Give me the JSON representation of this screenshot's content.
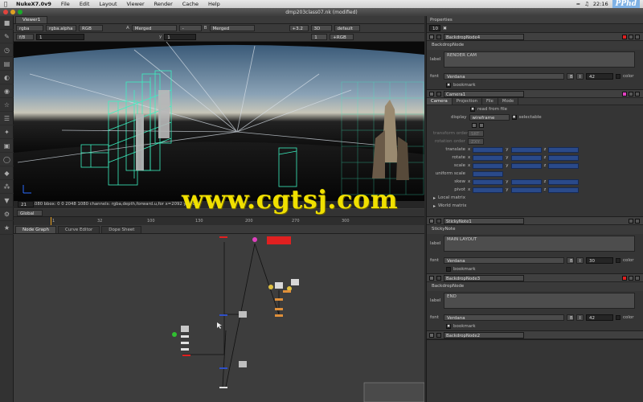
{
  "menubar": {
    "app": "NukeX7.0v9",
    "items": [
      "File",
      "Edit",
      "Layout",
      "Viewer",
      "Render",
      "Cache",
      "Help"
    ],
    "clock": "22:16",
    "logo": "PPhd"
  },
  "window": {
    "title": "dmp203class07.nk (modified)"
  },
  "viewer": {
    "tab": "Viewer1",
    "channels": "rgba",
    "alpha_channel": "rgba.alpha",
    "colorspace": "RGB",
    "a_label": "A",
    "a_input": "Merged",
    "b_label": "B",
    "b_input": "Merged",
    "zoom": "+3.2",
    "view_mode": "3D",
    "lut": "default",
    "aspect": "+RGB",
    "f_stop": "f/8",
    "frame_ratio": "1",
    "y_label": "y",
    "y_value": "1",
    "one": "1",
    "info": "2048x1080  bbox: 0 0 2048 1080 channels: rgba,depth,forward.u,for  x=2092 y=1008",
    "timeline_ticks": [
      "1",
      "32",
      "100",
      "130",
      "200",
      "270",
      "300"
    ],
    "current_frame": "21",
    "global_label": "Global"
  },
  "nodegraph": {
    "tabs": [
      "Node Graph",
      "Curve Editor",
      "Dope Sheet"
    ]
  },
  "watermark": "www.cgtsj.com",
  "properties": {
    "title": "Properties",
    "count": "10",
    "panels": [
      {
        "name": "BackdropNode4",
        "type": "BackdropNode",
        "label_title": "label",
        "label": "RENDER CAM",
        "font_label": "font",
        "font": "Verdana",
        "bold": "B",
        "italic": "I",
        "size": "42",
        "color_label": "color",
        "bookmark": "bookmark"
      },
      {
        "name": "Camera1",
        "tabs": [
          "Camera",
          "Projection",
          "File",
          "Mode"
        ],
        "read_from_file": "read from file",
        "display_label": "display",
        "display": "wireframe",
        "selectable": "selectable",
        "transform_order_label": "transform order",
        "transform_order": "SRT",
        "rotation_order_label": "rotation order",
        "rotation_order": "ZXY",
        "translate_label": "translate",
        "rotate_label": "rotate",
        "scale_label": "scale",
        "uniform_scale_label": "uniform scale",
        "skew_label": "skew",
        "pivot_label": "pivot",
        "local_matrix": "Local matrix",
        "world_matrix": "World matrix",
        "x": "x",
        "y": "y",
        "z": "z"
      },
      {
        "name": "StickyNote1",
        "type": "StickyNote",
        "label_title": "label",
        "label": "MAIN LAYOUT",
        "font_label": "font",
        "font": "Verdana",
        "bold": "B",
        "italic": "I",
        "size": "30",
        "color_label": "color",
        "bookmark": "bookmark"
      },
      {
        "name": "BackdropNode3",
        "type": "BackdropNode",
        "label_title": "label",
        "label": "END",
        "font_label": "font",
        "font": "Verdana",
        "bold": "B",
        "italic": "I",
        "size": "42",
        "color_label": "color",
        "bookmark": "bookmark"
      },
      {
        "name": "BackdropNode2"
      }
    ]
  },
  "colors": {
    "accent_red": "#e02020",
    "wire_cyan": "#3cf0c0",
    "node_magenta": "#e040c0",
    "watermark_yellow": "#f0e000"
  }
}
